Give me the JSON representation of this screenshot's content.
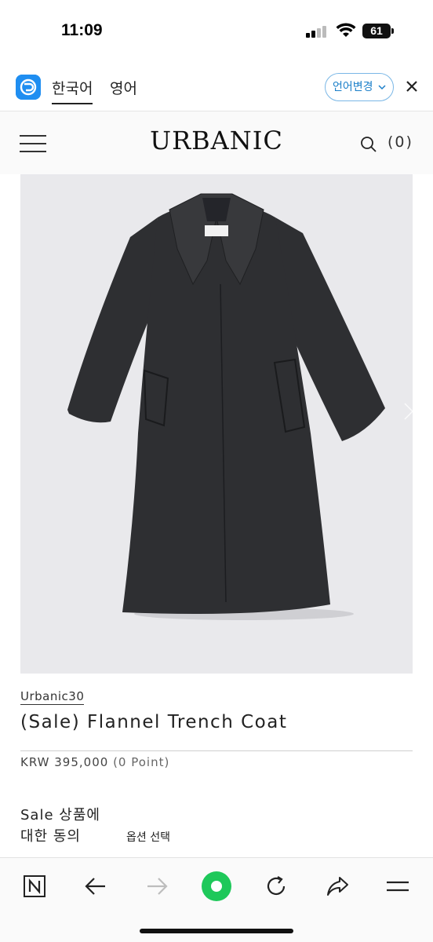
{
  "status_bar": {
    "time": "11:09",
    "battery_percent": "61",
    "battery_level": 0.61
  },
  "translate_bar": {
    "tab_korean": "한국어",
    "tab_english": "영어",
    "change_language": "언어변경",
    "close_icon": "close-icon"
  },
  "header": {
    "brand": "URBANIC",
    "cart_count": "(0)"
  },
  "product": {
    "brand": "Urbanic30",
    "name": "(Sale) Flannel Trench Coat",
    "price": "KRW 395,000",
    "points": "(0 Point)",
    "sale_consent_line1": "Sale 상품에",
    "sale_consent_line2": "대한 동의",
    "option_select": "옵션 선택",
    "image_bg": "#e9e9ec",
    "coat_color": "#2e2f32"
  },
  "toolbar": {
    "icons": [
      "naver-n-icon",
      "back-arrow-icon",
      "forward-arrow-icon",
      "green-dot-icon",
      "refresh-icon",
      "share-icon",
      "menu-icon"
    ],
    "accent_color": "#1ec85a"
  }
}
